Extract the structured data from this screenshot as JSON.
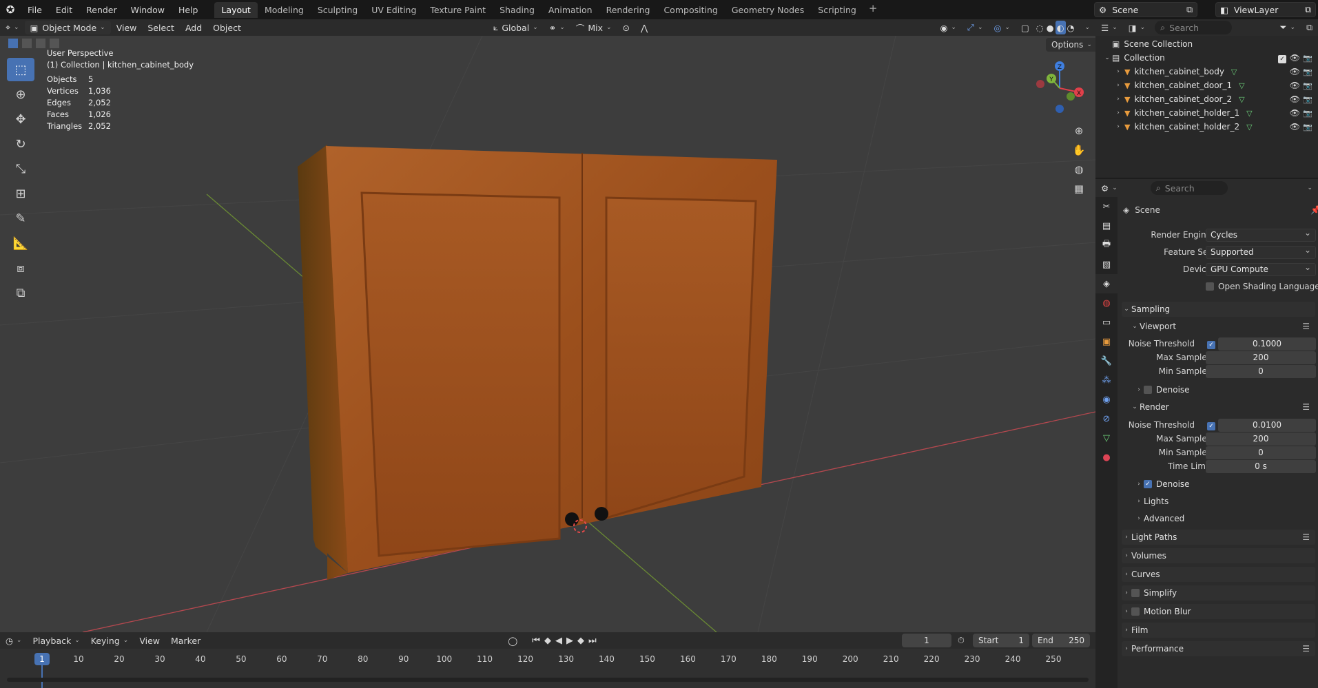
{
  "menubar": {
    "items": [
      "File",
      "Edit",
      "Render",
      "Window",
      "Help"
    ],
    "workspaces": [
      "Layout",
      "Modeling",
      "Sculpting",
      "UV Editing",
      "Texture Paint",
      "Shading",
      "Animation",
      "Rendering",
      "Compositing",
      "Geometry Nodes",
      "Scripting"
    ],
    "active_workspace": "Layout",
    "add_label": "+",
    "scene": "Scene",
    "view_layer": "ViewLayer"
  },
  "viewport_header": {
    "mode": "Object Mode",
    "menus": [
      "View",
      "Select",
      "Add",
      "Object"
    ],
    "orientation": "Global",
    "snap_mix": "Mix",
    "options": "Options"
  },
  "viewport": {
    "perspective": "User Perspective",
    "collection_path": "(1) Collection | kitchen_cabinet_body",
    "stats": [
      {
        "key": "Objects",
        "value": "5"
      },
      {
        "key": "Vertices",
        "value": "1,036"
      },
      {
        "key": "Edges",
        "value": "2,052"
      },
      {
        "key": "Faces",
        "value": "1,026"
      },
      {
        "key": "Triangles",
        "value": "2,052"
      }
    ],
    "gizmo": {
      "x": "X",
      "y": "Y",
      "z": "Z"
    }
  },
  "timeline_header": {
    "menus": [
      "Playback",
      "Keying",
      "View",
      "Marker"
    ],
    "current_frame": "1",
    "start_label": "Start",
    "start": "1",
    "end_label": "End",
    "end": "250"
  },
  "timeline": {
    "frames": [
      "1",
      "10",
      "20",
      "30",
      "40",
      "50",
      "60",
      "70",
      "80",
      "90",
      "100",
      "110",
      "120",
      "130",
      "140",
      "150",
      "160",
      "170",
      "180",
      "190",
      "200",
      "210",
      "220",
      "230",
      "240",
      "250"
    ]
  },
  "outliner": {
    "search_placeholder": "Search",
    "scene_collection": "Scene Collection",
    "collection": "Collection",
    "objects": [
      "kitchen_cabinet_body",
      "kitchen_cabinet_door_1",
      "kitchen_cabinet_door_2",
      "kitchen_cabinet_holder_1",
      "kitchen_cabinet_holder_2"
    ]
  },
  "properties": {
    "search_placeholder": "Search",
    "context": "Scene",
    "render_engine_label": "Render Engine",
    "render_engine": "Cycles",
    "feature_set_label": "Feature Set",
    "feature_set": "Supported",
    "device_label": "Device",
    "device": "GPU Compute",
    "osl_label": "Open Shading Language",
    "sampling": "Sampling",
    "viewport": "Viewport",
    "vp_noise_label": "Noise Threshold",
    "vp_noise": "0.1000",
    "vp_max_label": "Max Samples",
    "vp_max": "200",
    "vp_min_label": "Min Samples",
    "vp_min": "0",
    "vp_denoise": "Denoise",
    "render": "Render",
    "r_noise_label": "Noise Threshold",
    "r_noise": "0.0100",
    "r_max_label": "Max Samples",
    "r_max": "200",
    "r_min_label": "Min Samples",
    "r_min": "0",
    "r_time_label": "Time Limit",
    "r_time": "0 s",
    "r_denoise": "Denoise",
    "lights": "Lights",
    "advanced": "Advanced",
    "light_paths": "Light Paths",
    "volumes": "Volumes",
    "curves": "Curves",
    "simplify": "Simplify",
    "motion_blur": "Motion Blur",
    "film": "Film",
    "performance": "Performance"
  },
  "colors": {
    "accent": "#4772b3",
    "wood": "#a0511c",
    "x_axis": "#e0404a",
    "y_axis": "#7fb53c",
    "z_axis": "#3f7fe0"
  }
}
